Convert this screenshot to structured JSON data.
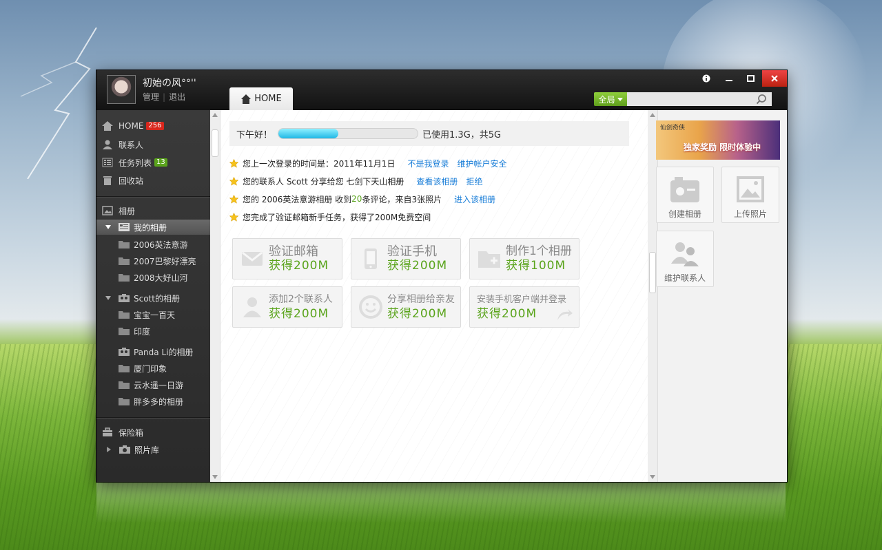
{
  "user": {
    "name": "初始の风°°''",
    "manage": "管理",
    "logout": "退出"
  },
  "tabs": {
    "home": "HOME"
  },
  "search": {
    "scope": "全局",
    "value": ""
  },
  "window_controls": {
    "info": "i",
    "minimize": "—",
    "maximize": "□",
    "close": "×"
  },
  "sidebar": {
    "home": {
      "label": "HOME",
      "badge": "256"
    },
    "contacts": "联系人",
    "tasks": {
      "label": "任务列表",
      "badge": "13"
    },
    "recycle": "回收站",
    "albums": "相册",
    "my_albums": {
      "label": "我的相册",
      "items": [
        "2006英法意游",
        "2007巴黎好漂亮",
        "2008大好山河"
      ]
    },
    "scott_albums": {
      "label": "Scott的相册",
      "items": [
        "宝宝一百天",
        "印度"
      ]
    },
    "panda_albums": {
      "label": "Panda Li的相册",
      "items": [
        "厦门印象",
        "云水遥一日游",
        "胖多多的相册"
      ]
    },
    "safe": "保险箱",
    "photo_library": "照片库"
  },
  "greeting": {
    "text": "下午好！",
    "usage": "已使用1.3G，共5G",
    "used_fraction": 0.43
  },
  "notices": [
    {
      "text": "您上一次登录的时间是：2011年11月1日",
      "links": [
        "不是我登录",
        "维护帐户安全"
      ]
    },
    {
      "prefix": "您的联系人 Scott 分享给您 七剑下天山相册",
      "links": [
        "查看该相册",
        "拒绝"
      ]
    },
    {
      "prefix": "您的 2006英法意游相册 收到",
      "count": "20",
      "suffix": "条评论，来自3张照片",
      "links": [
        "进入该相册"
      ]
    },
    {
      "text": "您完成了验证邮箱新手任务，获得了200M免费空间"
    }
  ],
  "tasks": [
    {
      "icon": "envelope-icon",
      "title": "验证邮箱",
      "reward": "获得200M"
    },
    {
      "icon": "phone-icon",
      "title": "验证手机",
      "reward": "获得200M"
    },
    {
      "icon": "folder-plus-icon",
      "title": "制作1个相册",
      "reward": "获得100M"
    },
    {
      "icon": "person-icon",
      "title": "添加2个联系人",
      "reward": "获得200M"
    },
    {
      "icon": "smile-icon",
      "title": "分享相册给亲友",
      "reward": "获得200M"
    },
    {
      "icon": "mobile-sync-icon",
      "title": "安装手机客户端并登录",
      "reward": "获得200M"
    }
  ],
  "right": {
    "banner": {
      "logo": "仙剑奇侠",
      "text": "独家奖励 限时体验中"
    },
    "quick": [
      "创建相册",
      "上传照片",
      "维护联系人"
    ]
  },
  "colors": {
    "accent_green": "#5aa41c",
    "link_blue": "#1a7ed8",
    "badge_red": "#d9261c",
    "progress_cyan": "#1fb8e6"
  }
}
